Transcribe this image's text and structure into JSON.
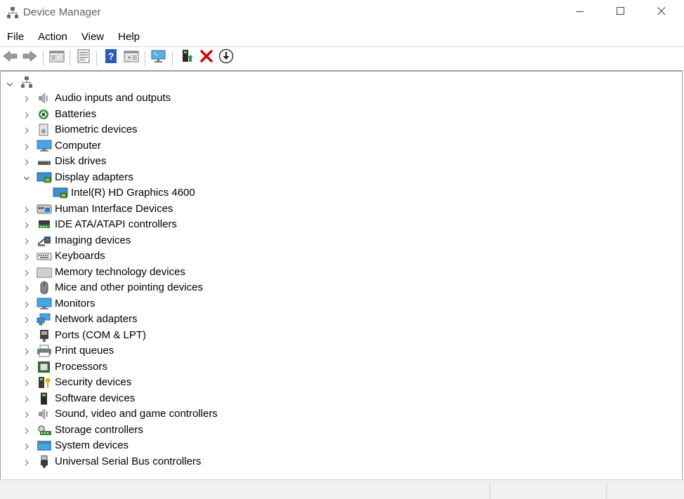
{
  "window": {
    "title": "Device Manager",
    "icon": "device-manager-icon",
    "controls": [
      "minimize-icon",
      "maximize-icon",
      "close-icon"
    ]
  },
  "menu": {
    "items": [
      "File",
      "Action",
      "View",
      "Help"
    ]
  },
  "toolbar": {
    "buttons": [
      {
        "icon": "back-arrow-icon"
      },
      {
        "icon": "forward-arrow-icon"
      },
      {
        "icon": "show-hide-console-tree-icon"
      },
      {
        "icon": "properties-icon"
      },
      {
        "icon": "help-icon"
      },
      {
        "icon": "show-action-pane-icon"
      },
      {
        "icon": "scan-hardware-changes-icon"
      },
      {
        "icon": "update-driver-icon"
      },
      {
        "icon": "uninstall-device-icon"
      },
      {
        "icon": "disable-device-icon"
      }
    ]
  },
  "tree": {
    "root": {
      "expanded": true,
      "icon": "computer-root-icon"
    },
    "categories": [
      {
        "label": "Audio inputs and outputs",
        "icon": "speaker-icon",
        "expanded": false
      },
      {
        "label": "Batteries",
        "icon": "battery-icon",
        "expanded": false
      },
      {
        "label": "Biometric devices",
        "icon": "fingerprint-icon",
        "expanded": false
      },
      {
        "label": "Computer",
        "icon": "computer-icon",
        "expanded": false
      },
      {
        "label": "Disk drives",
        "icon": "disk-drive-icon",
        "expanded": false
      },
      {
        "label": "Display adapters",
        "icon": "display-adapter-icon",
        "expanded": true,
        "children": [
          {
            "label": "Intel(R) HD Graphics 4600",
            "icon": "display-adapter-icon"
          }
        ]
      },
      {
        "label": "Human Interface Devices",
        "icon": "hid-icon",
        "expanded": false
      },
      {
        "label": "IDE ATA/ATAPI controllers",
        "icon": "ide-controller-icon",
        "expanded": false
      },
      {
        "label": "Imaging devices",
        "icon": "camera-icon",
        "expanded": false
      },
      {
        "label": "Keyboards",
        "icon": "keyboard-icon",
        "expanded": false
      },
      {
        "label": "Memory technology devices",
        "icon": "memory-icon",
        "expanded": false
      },
      {
        "label": "Mice and other pointing devices",
        "icon": "mouse-icon",
        "expanded": false
      },
      {
        "label": "Monitors",
        "icon": "monitor-icon",
        "expanded": false
      },
      {
        "label": "Network adapters",
        "icon": "network-icon",
        "expanded": false
      },
      {
        "label": "Ports (COM & LPT)",
        "icon": "port-icon",
        "expanded": false
      },
      {
        "label": "Print queues",
        "icon": "printer-icon",
        "expanded": false
      },
      {
        "label": "Processors",
        "icon": "processor-icon",
        "expanded": false
      },
      {
        "label": "Security devices",
        "icon": "security-key-icon",
        "expanded": false
      },
      {
        "label": "Software devices",
        "icon": "software-device-icon",
        "expanded": false
      },
      {
        "label": "Sound, video and game controllers",
        "icon": "speaker-icon",
        "expanded": false
      },
      {
        "label": "Storage controllers",
        "icon": "storage-controller-icon",
        "expanded": false
      },
      {
        "label": "System devices",
        "icon": "system-folder-icon",
        "expanded": false
      },
      {
        "label": "Universal Serial Bus controllers",
        "icon": "usb-icon",
        "expanded": false
      }
    ]
  },
  "colors": {
    "title_text": "#5f5f5f",
    "uninstall_red": "#d60000",
    "help_blue": "#2e5bb8",
    "monitor_blue": "#2a8fd6",
    "status_bar": "#f0f0f0"
  }
}
